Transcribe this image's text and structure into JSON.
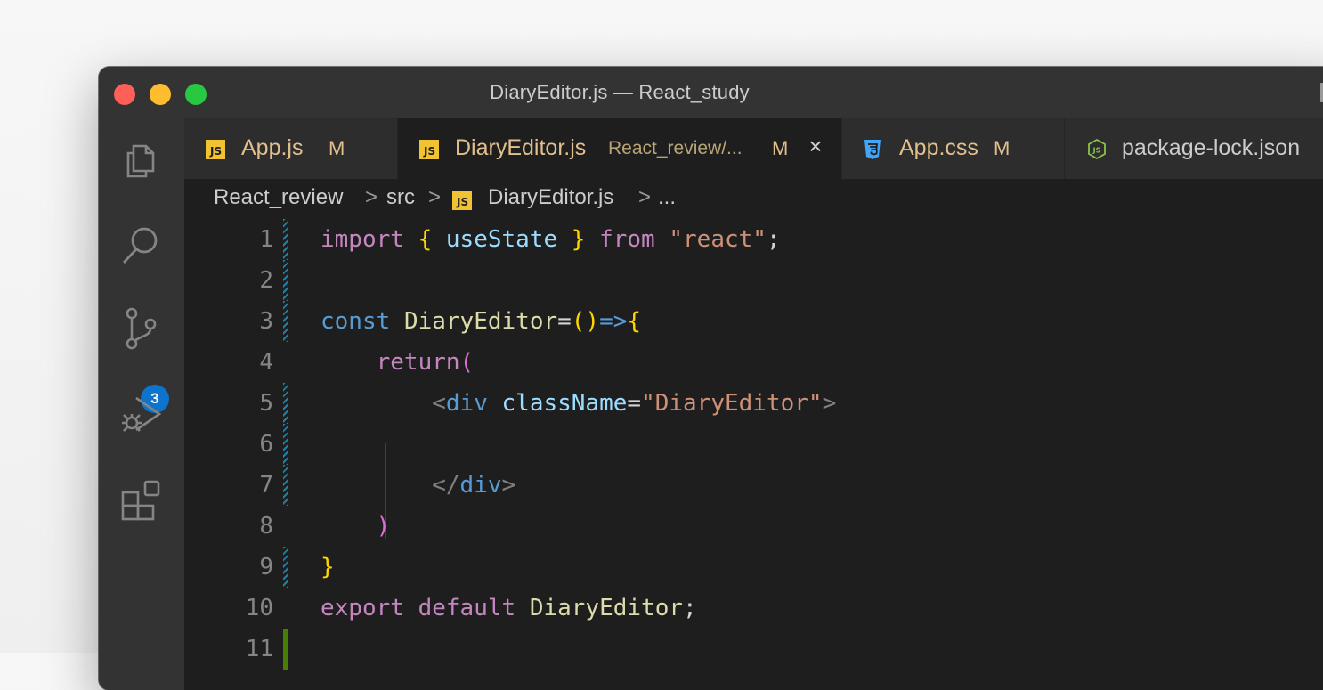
{
  "window": {
    "title": "DiaryEditor.js — React_study"
  },
  "activity_bar": {
    "items": [
      {
        "icon": "files-icon",
        "name": "Explorer"
      },
      {
        "icon": "search-icon",
        "name": "Search"
      },
      {
        "icon": "source-control-icon",
        "name": "Source Control",
        "badge": "3"
      },
      {
        "icon": "run-debug-icon",
        "name": "Run and Debug"
      },
      {
        "icon": "extensions-icon",
        "name": "Extensions"
      }
    ]
  },
  "tabs": [
    {
      "label": "App.js",
      "icon": "js-file-icon",
      "status": "M",
      "active": false
    },
    {
      "label": "DiaryEditor.js",
      "icon": "js-file-icon",
      "description": "React_review/...",
      "status": "M",
      "active": true,
      "close": "×"
    },
    {
      "label": "App.css",
      "icon": "css-file-icon",
      "status": "M",
      "active": false
    },
    {
      "label": "package-lock.json",
      "icon": "nodejs-icon",
      "active": false
    }
  ],
  "breadcrumb": {
    "parts": [
      "React_review",
      "src",
      "DiaryEditor.js",
      "..."
    ],
    "separator": ">"
  },
  "editor": {
    "line_numbers": [
      "1",
      "2",
      "3",
      "4",
      "5",
      "6",
      "7",
      "8",
      "9",
      "10",
      "11"
    ],
    "lines": [
      [
        {
          "t": "import",
          "c": "kw-pink"
        },
        {
          "t": " ",
          "c": "plain"
        },
        {
          "t": "{",
          "c": "b1"
        },
        {
          "t": " useState ",
          "c": "var"
        },
        {
          "t": "}",
          "c": "b1"
        },
        {
          "t": " ",
          "c": "plain"
        },
        {
          "t": "from",
          "c": "kw-pink"
        },
        {
          "t": " ",
          "c": "plain"
        },
        {
          "t": "\"react\"",
          "c": "str"
        },
        {
          "t": ";",
          "c": "plain"
        }
      ],
      [],
      [
        {
          "t": "const",
          "c": "kw-blue"
        },
        {
          "t": " ",
          "c": "plain"
        },
        {
          "t": "DiaryEditor",
          "c": "fn"
        },
        {
          "t": "=",
          "c": "plain"
        },
        {
          "t": "()",
          "c": "b1"
        },
        {
          "t": "=>",
          "c": "kw-blue"
        },
        {
          "t": "{",
          "c": "b1"
        }
      ],
      [
        {
          "t": "    ",
          "c": "plain"
        },
        {
          "t": "return",
          "c": "kw-pink"
        },
        {
          "t": "(",
          "c": "b2"
        }
      ],
      [
        {
          "t": "        ",
          "c": "plain"
        },
        {
          "t": "<",
          "c": "tagpunct"
        },
        {
          "t": "div",
          "c": "kw-blue"
        },
        {
          "t": " ",
          "c": "plain"
        },
        {
          "t": "className",
          "c": "attr"
        },
        {
          "t": "=",
          "c": "plain"
        },
        {
          "t": "\"DiaryEditor\"",
          "c": "str"
        },
        {
          "t": ">",
          "c": "tagpunct"
        }
      ],
      [],
      [
        {
          "t": "        ",
          "c": "plain"
        },
        {
          "t": "</",
          "c": "tagpunct"
        },
        {
          "t": "div",
          "c": "kw-blue"
        },
        {
          "t": ">",
          "c": "tagpunct"
        }
      ],
      [
        {
          "t": "    ",
          "c": "plain"
        },
        {
          "t": ")",
          "c": "b2"
        }
      ],
      [
        {
          "t": "}",
          "c": "b1"
        }
      ],
      [
        {
          "t": "export",
          "c": "kw-pink"
        },
        {
          "t": " ",
          "c": "plain"
        },
        {
          "t": "default",
          "c": "kw-pink"
        },
        {
          "t": " ",
          "c": "plain"
        },
        {
          "t": "DiaryEditor",
          "c": "fn"
        },
        {
          "t": ";",
          "c": "plain"
        }
      ],
      []
    ],
    "gutter_changes": [
      {
        "line": 1,
        "type": "modified"
      },
      {
        "line": 2,
        "type": "modified"
      },
      {
        "line": 3,
        "type": "modified"
      },
      {
        "line": 5,
        "type": "modified"
      },
      {
        "line": 6,
        "type": "modified"
      },
      {
        "line": 7,
        "type": "modified"
      },
      {
        "line": 9,
        "type": "modified"
      },
      {
        "line": 11,
        "type": "added"
      }
    ]
  },
  "colors": {
    "editor_bg": "#1e1e1e",
    "sidebar_bg": "#333333",
    "modified_file": "#e2c08d",
    "badge": "#0e73cc"
  }
}
